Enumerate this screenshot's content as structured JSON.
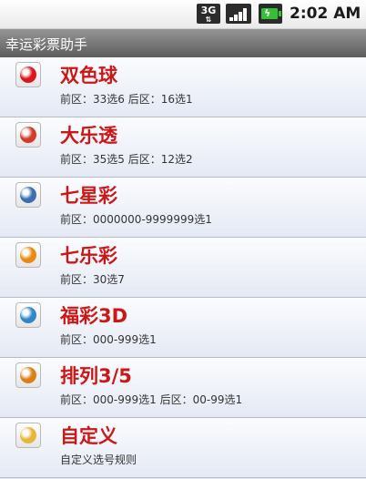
{
  "status_bar": {
    "network_label": "3G",
    "network_icon": "3g-data-icon",
    "signal_icon": "signal-strength-icon",
    "battery_icon": "battery-charging-icon",
    "time": "2:02 AM"
  },
  "app": {
    "title": "幸运彩票助手"
  },
  "lotteries": [
    {
      "name": "双色球",
      "rule": "前区：33选6  后区：16选1",
      "icon": "shuangseqiu-logo-icon",
      "color": "#d9161c"
    },
    {
      "name": "大乐透",
      "rule": "前区：35选5  后区：12选2",
      "icon": "daletou-logo-icon",
      "color": "#d23a2a"
    },
    {
      "name": "七星彩",
      "rule": "前区：0000000-9999999选1",
      "icon": "qixingcai-logo-icon",
      "color": "#3a6fb0"
    },
    {
      "name": "七乐彩",
      "rule": "前区：30选7",
      "icon": "qilecai-logo-icon",
      "color": "#e88a10"
    },
    {
      "name": "福彩3D",
      "rule": "前区：000-999选1",
      "icon": "fucai3d-logo-icon",
      "color": "#2f86c8"
    },
    {
      "name": "排列3/5",
      "rule": "前区：000-999选1  后区：00-99选1",
      "icon": "pailie-logo-icon",
      "color": "#d9801a"
    },
    {
      "name": "自定义",
      "rule": "自定义选号规则",
      "icon": "custom-logo-icon",
      "color": "#e6b63a"
    }
  ]
}
